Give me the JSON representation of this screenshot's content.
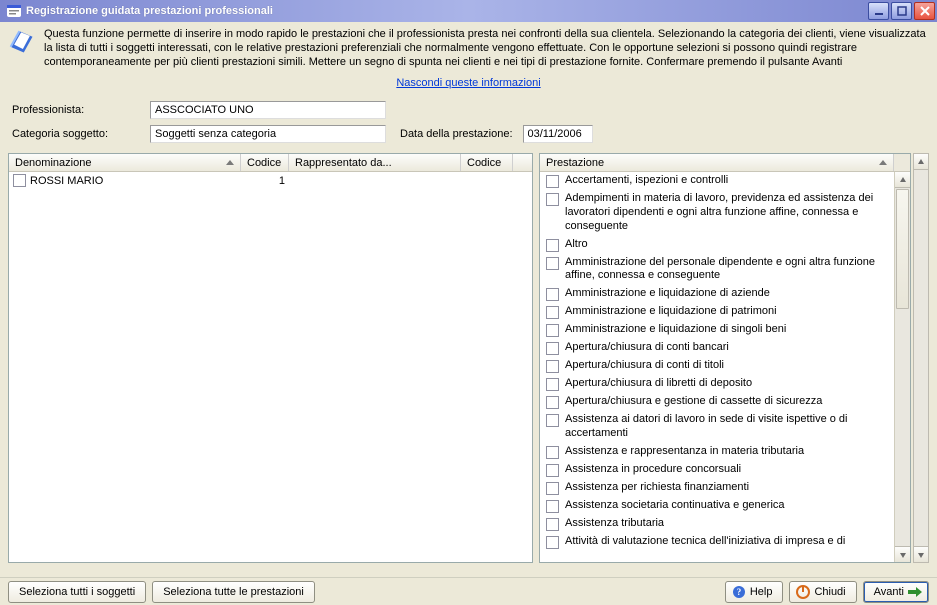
{
  "window": {
    "title": "Registrazione guidata prestazioni professionali"
  },
  "banner": {
    "text": "Questa funzione permette di inserire in modo rapido le prestazioni che il professionista presta nei confronti della sua clientela. Selezionando la categoria dei clienti, viene visualizzata la lista di tutti i soggetti interessati, con le relative prestazioni preferenziali che normalmente vengono effettuate. Con le opportune selezioni si possono quindi registrare contemporaneamente per più clienti prestazioni simili. Mettere un segno di spunta nei clienti e nei tipi di prestazione fornite. Confermare premendo il pulsante Avanti"
  },
  "links": {
    "hide_info": "Nascondi queste informazioni"
  },
  "form": {
    "professionista_label": "Professionista:",
    "professionista_value": "ASSCOCIATO UNO",
    "categoria_label": "Categoria soggetto:",
    "categoria_value": "Soggetti senza categoria",
    "data_label": "Data della prestazione:",
    "data_value": "03/11/2006"
  },
  "left_table": {
    "headers": {
      "denom": "Denominazione",
      "codice1": "Codice",
      "rappr": "Rappresentato da...",
      "codice2": "Codice"
    },
    "rows": [
      {
        "denom": "ROSSI MARIO",
        "codice1": "1",
        "rappr": "",
        "codice2": ""
      }
    ]
  },
  "right_table": {
    "header": "Prestazione",
    "rows": [
      "Accertamenti, ispezioni e controlli",
      "Adempimenti in materia di lavoro, previdenza ed assistenza dei lavoratori dipendenti e ogni altra funzione affine, connessa e conseguente",
      "Altro",
      "Amministrazione del personale dipendente e ogni altra funzione affine, connessa e conseguente",
      "Amministrazione e liquidazione di aziende",
      "Amministrazione e liquidazione di patrimoni",
      "Amministrazione e liquidazione di singoli beni",
      "Apertura/chiusura di conti bancari",
      "Apertura/chiusura di conti di titoli",
      "Apertura/chiusura di libretti di deposito",
      "Apertura/chiusura e gestione di cassette di sicurezza",
      "Assistenza ai datori di lavoro in sede di visite ispettive o di accertamenti",
      "Assistenza e rappresentanza in materia tributaria",
      "Assistenza in procedure concorsuali",
      "Assistenza per richiesta finanziamenti",
      "Assistenza societaria continuativa e generica",
      "Assistenza tributaria",
      "Attività di valutazione tecnica dell'iniziativa di impresa e di"
    ]
  },
  "buttons": {
    "select_all_subjects": "Seleziona tutti i soggetti",
    "select_all_services": "Seleziona tutte le prestazioni",
    "help": "Help",
    "close": "Chiudi",
    "next": "Avanti"
  }
}
